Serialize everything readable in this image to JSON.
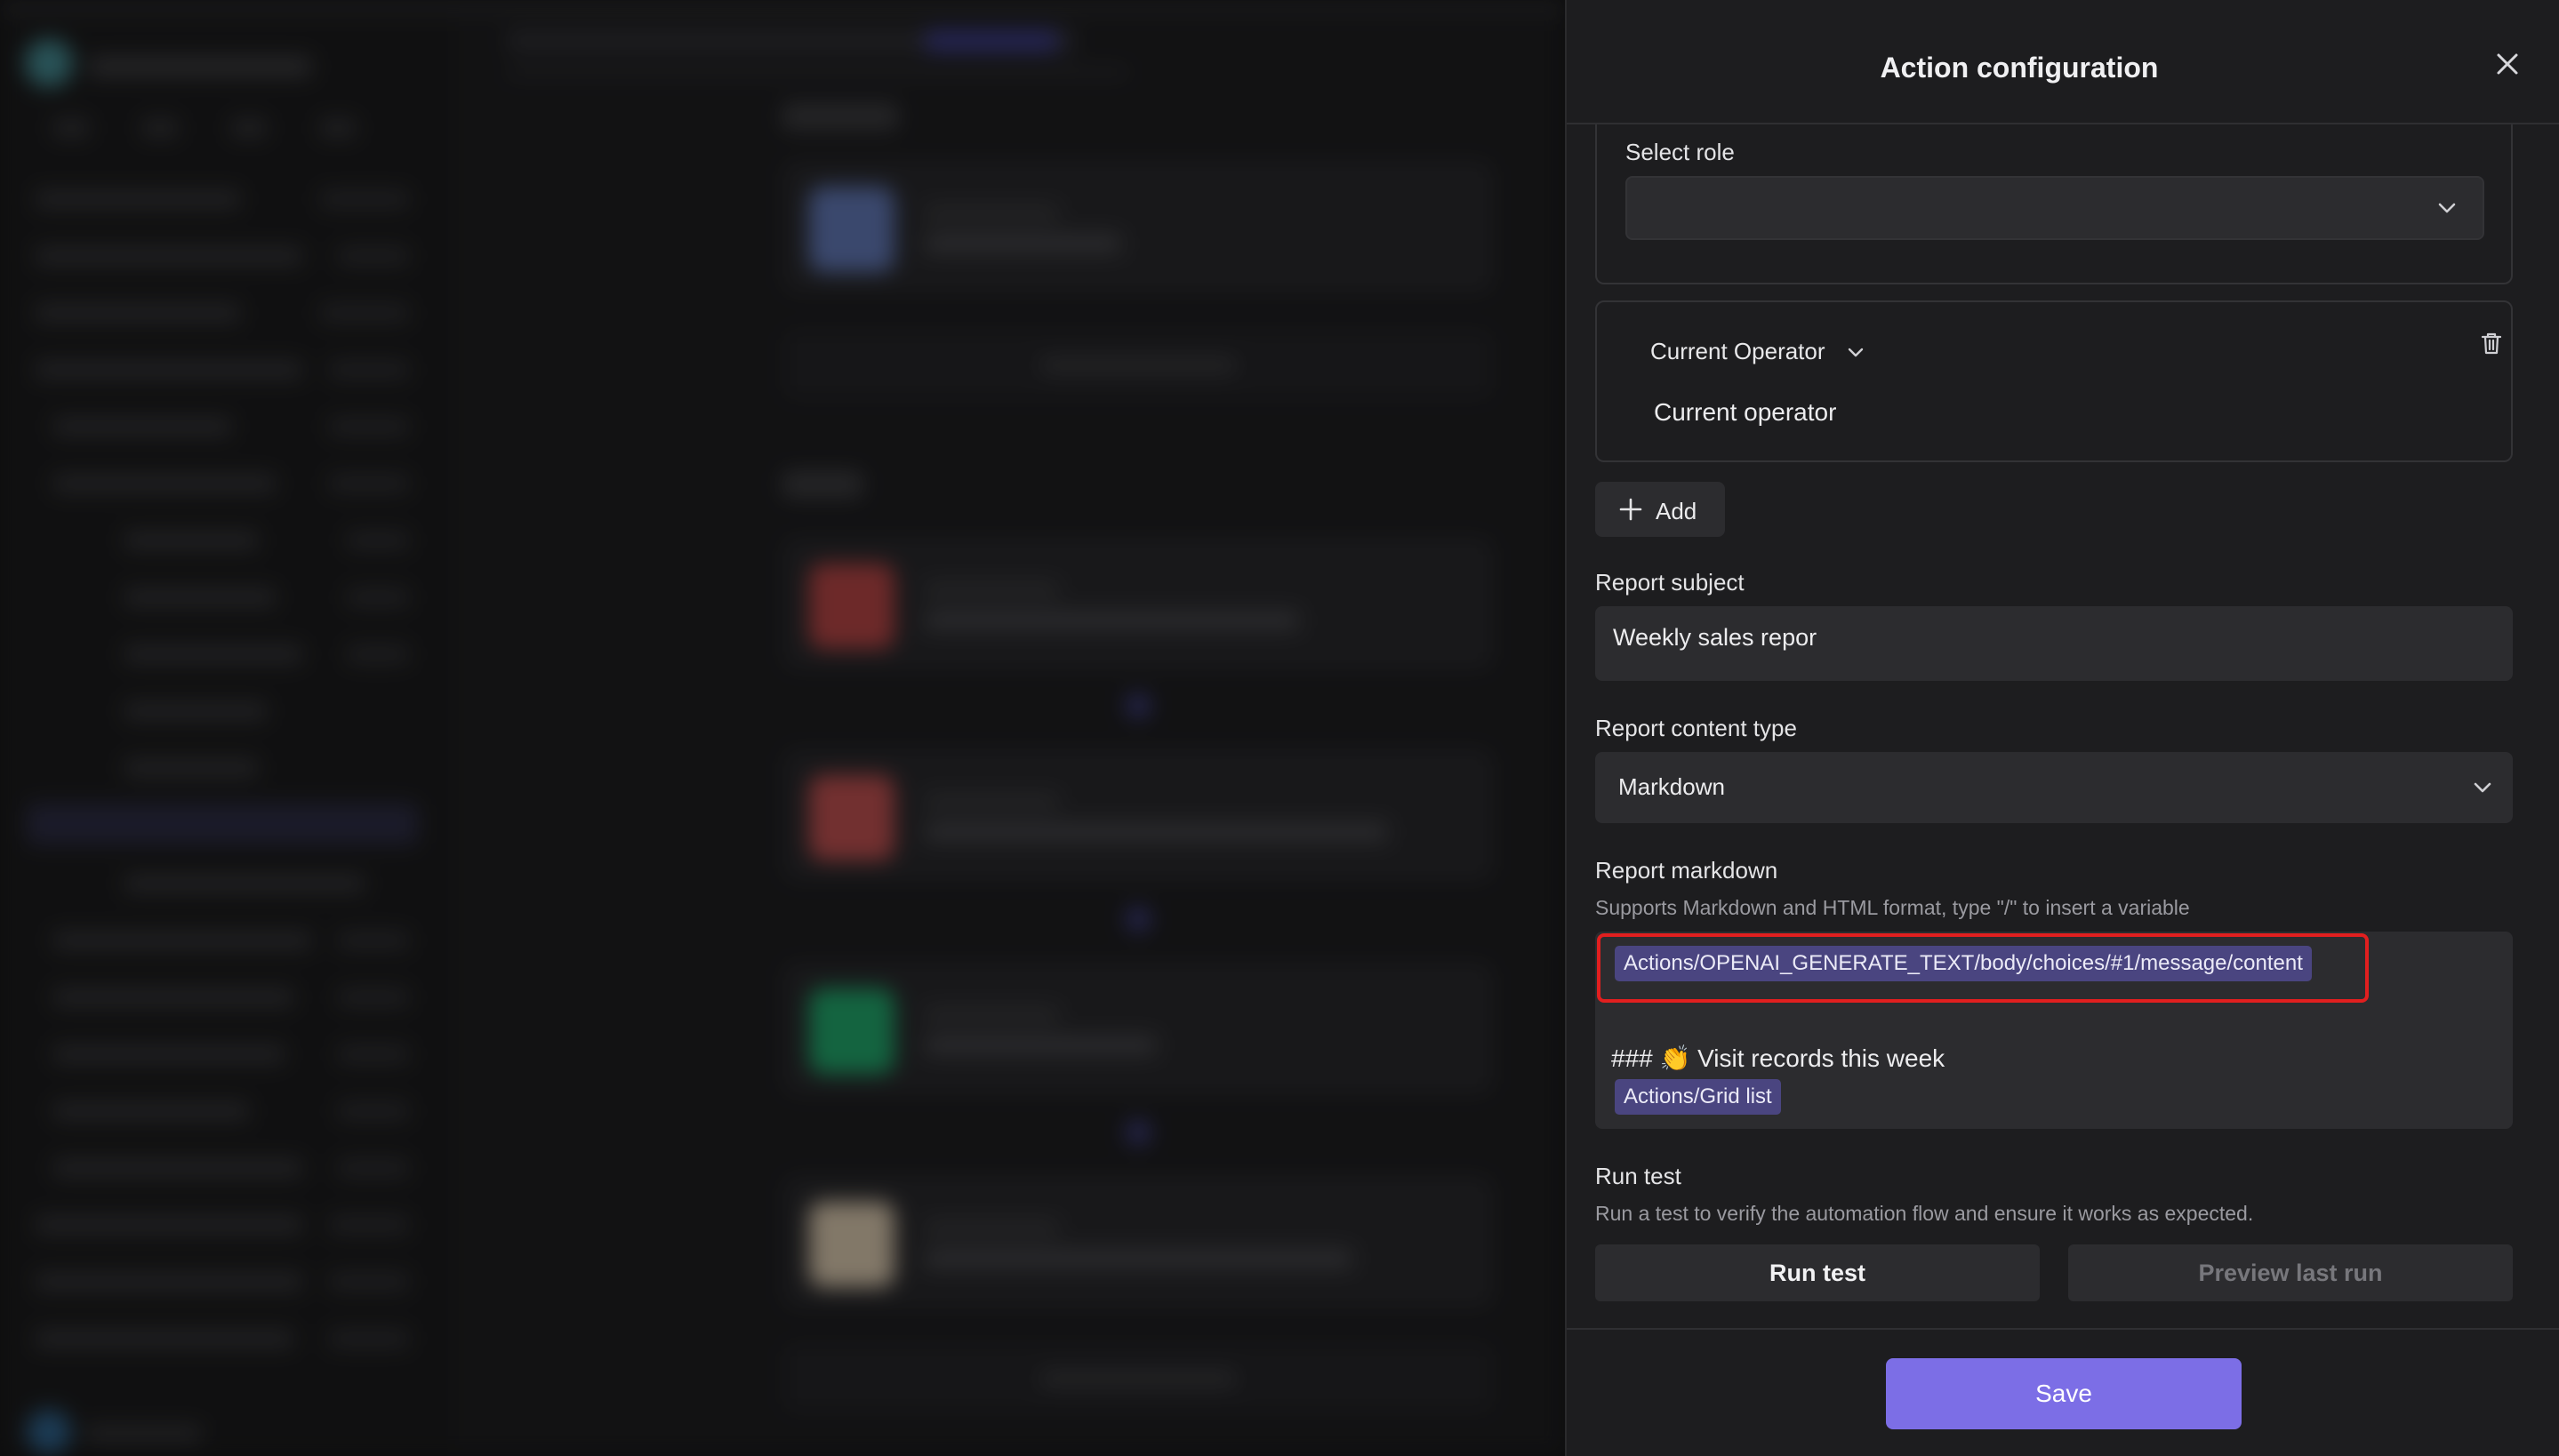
{
  "drawer": {
    "title": "Action configuration",
    "select_role": {
      "label": "Select role",
      "value": ""
    },
    "operator": {
      "dropdown_label": "Current Operator",
      "value_text": "Current operator"
    },
    "add_label": "Add",
    "report_subject": {
      "label": "Report subject",
      "value": "Weekly sales repor"
    },
    "report_content_type": {
      "label": "Report content type",
      "value": "Markdown"
    },
    "report_markdown": {
      "label": "Report markdown",
      "hint": "Supports Markdown and HTML format, type \"/\" to insert a variable",
      "variable_1": "Actions/OPENAI_GENERATE_TEXT/body/choices/#1/message/content",
      "heading_line": "### 👏 Visit records this week",
      "variable_2": "Actions/Grid list"
    },
    "run_test": {
      "label": "Run test",
      "hint": "Run a test to verify the automation flow and ensure it works as expected.",
      "run_button": "Run test",
      "preview_button": "Preview last run"
    },
    "save_label": "Save"
  },
  "colors": {
    "accent": "#7c6ee6",
    "highlight_frame": "#e11f1f",
    "variable_chip": "#4a4580"
  },
  "icons": {
    "close": "close-icon",
    "select_chevron": "chevron-down-icon",
    "operator_chevron": "chevron-down-icon",
    "delete": "trash-icon",
    "add": "plus-icon"
  }
}
